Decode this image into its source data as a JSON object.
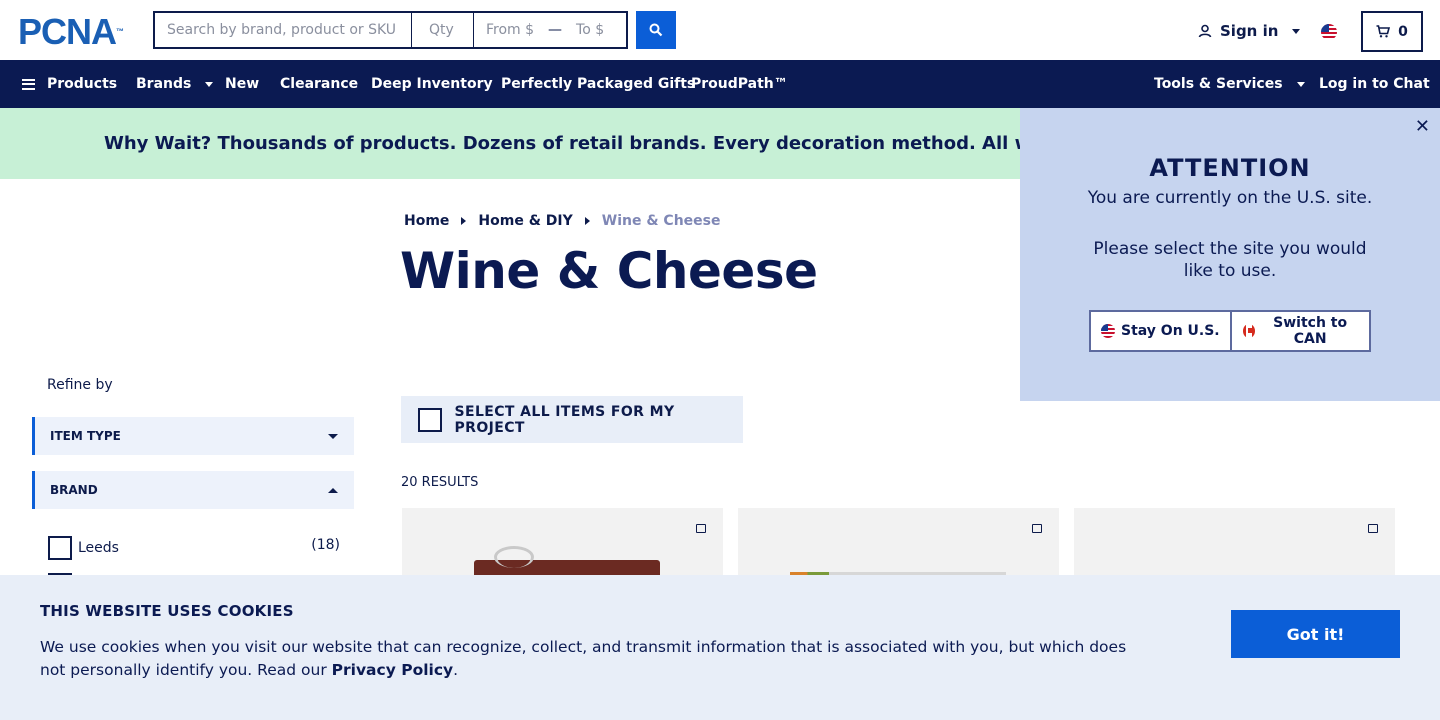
{
  "header": {
    "logo_text": "PCNA",
    "logo_tm": "™",
    "search_placeholder": "Search by brand, product or SKU",
    "qty_placeholder": "Qty",
    "price_from_placeholder": "From $",
    "price_separator": "—",
    "price_to_placeholder": "To $",
    "sign_in_label": "Sign in",
    "cart_count": "0"
  },
  "nav": {
    "products": "Products",
    "brands": "Brands",
    "new": "New",
    "clearance": "Clearance",
    "deep_inventory": "Deep Inventory",
    "gifts": "Perfectly Packaged Gifts",
    "proudpath": "ProudPath™",
    "tools": "Tools & Services",
    "chat": "Log in to Chat"
  },
  "banner": {
    "text": "Why Wait? Thousands of products. Dozens of retail brands. Every decoration method. All with a standard"
  },
  "breadcrumb": {
    "home": "Home",
    "category": "Home & DIY",
    "current": "Wine & Cheese"
  },
  "page_title": "Wine & Cheese",
  "sidebar": {
    "refine_label": "Refine by",
    "facets": [
      {
        "label": "ITEM TYPE",
        "expanded": false
      },
      {
        "label": "BRAND",
        "expanded": true
      }
    ],
    "brand_options": [
      {
        "label": "Leeds",
        "count": "(18)"
      }
    ]
  },
  "listing": {
    "select_all_label": "SELECT ALL ITEMS FOR MY PROJECT",
    "results_label": "20 RESULTS"
  },
  "attention_modal": {
    "close": "✕",
    "title": "ATTENTION",
    "message1": "You are currently on the U.S. site.",
    "message2": "Please select the site you would like to use.",
    "stay_label": "Stay On U.S.",
    "switch_label": "Switch to CAN"
  },
  "cookie_banner": {
    "title": "THIS WEBSITE USES COOKIES",
    "text": "We use cookies when you visit our website that can recognize, collect, and transmit information that is associated with you, but which does not personally identify you. Read our ",
    "link": "Privacy Policy",
    "end": ".",
    "button": "Got it!"
  },
  "colors": {
    "navy": "#0b1a52",
    "accent_blue": "#0b5ed7",
    "banner_green": "#c7f0d6",
    "modal_bg": "#c6d4ef",
    "cookie_bg": "#e8eef8"
  }
}
